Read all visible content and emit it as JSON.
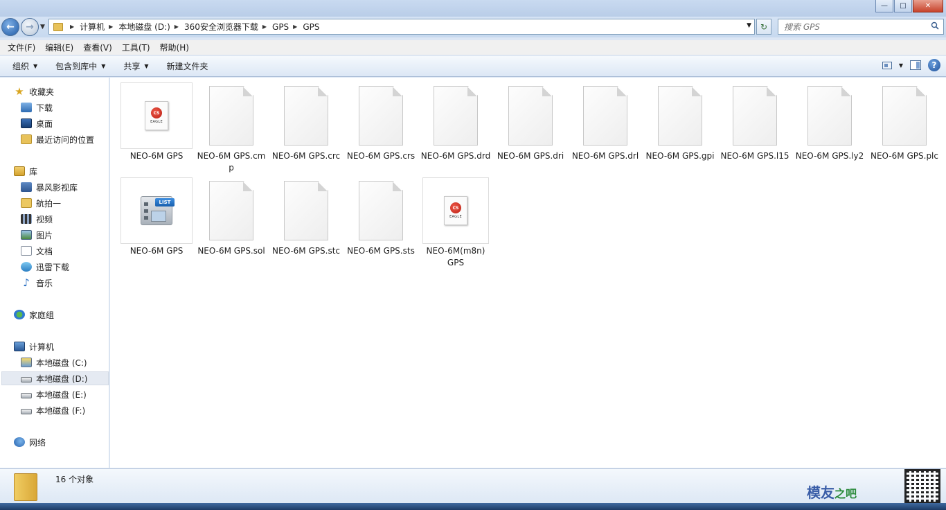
{
  "window": {
    "minimize": "—",
    "maximize": "□",
    "close": "✕"
  },
  "address": {
    "crumbs": [
      "计算机",
      "本地磁盘 (D:)",
      "360安全浏览器下载",
      "GPS",
      "GPS"
    ],
    "search_placeholder": "搜索 GPS"
  },
  "menu": [
    "文件(F)",
    "编辑(E)",
    "查看(V)",
    "工具(T)",
    "帮助(H)"
  ],
  "toolbar": {
    "organize": "组织",
    "include_library": "包含到库中",
    "share": "共享",
    "new_folder": "新建文件夹"
  },
  "nav": {
    "favorites": "收藏夹",
    "downloads": "下载",
    "desktop": "桌面",
    "recent": "最近访问的位置",
    "libraries": "库",
    "baofeng": "暴风影视库",
    "aerial": "航拍一",
    "videos": "视频",
    "pictures": "图片",
    "documents": "文档",
    "thunder": "迅雷下载",
    "music": "音乐",
    "homegroup": "家庭组",
    "computer": "计算机",
    "drive_c": "本地磁盘 (C:)",
    "drive_d": "本地磁盘 (D:)",
    "drive_e": "本地磁盘 (E:)",
    "drive_f": "本地磁盘 (F:)",
    "network": "网络"
  },
  "files": [
    {
      "name": "NEO-6M GPS",
      "icon": "eagle-icon"
    },
    {
      "name": "NEO-6M GPS.cmp",
      "icon": "blank-file-icon"
    },
    {
      "name": "NEO-6M GPS.crc",
      "icon": "blank-file-icon"
    },
    {
      "name": "NEO-6M GPS.crs",
      "icon": "blank-file-icon"
    },
    {
      "name": "NEO-6M GPS.drd",
      "icon": "blank-file-icon"
    },
    {
      "name": "NEO-6M GPS.dri",
      "icon": "blank-file-icon"
    },
    {
      "name": "NEO-6M GPS.drl",
      "icon": "blank-file-icon"
    },
    {
      "name": "NEO-6M GPS.gpi",
      "icon": "blank-file-icon"
    },
    {
      "name": "NEO-6M GPS.l15",
      "icon": "blank-file-icon"
    },
    {
      "name": "NEO-6M GPS.ly2",
      "icon": "blank-file-icon"
    },
    {
      "name": "NEO-6M GPS.plc",
      "icon": "blank-file-icon"
    },
    {
      "name": "NEO-6M GPS",
      "icon": "list-file-icon"
    },
    {
      "name": "NEO-6M GPS.sol",
      "icon": "blank-file-icon"
    },
    {
      "name": "NEO-6M GPS.stc",
      "icon": "blank-file-icon"
    },
    {
      "name": "NEO-6M GPS.sts",
      "icon": "blank-file-icon"
    },
    {
      "name": "NEO-6M(m8n) GPS",
      "icon": "eagle-icon"
    }
  ],
  "eagle_badge": "CS",
  "eagle_label": "EAGLE",
  "list_badge": "LIST",
  "status": {
    "count": "16 个对象"
  },
  "watermark": {
    "text": "模友",
    "suffix": "之吧"
  }
}
